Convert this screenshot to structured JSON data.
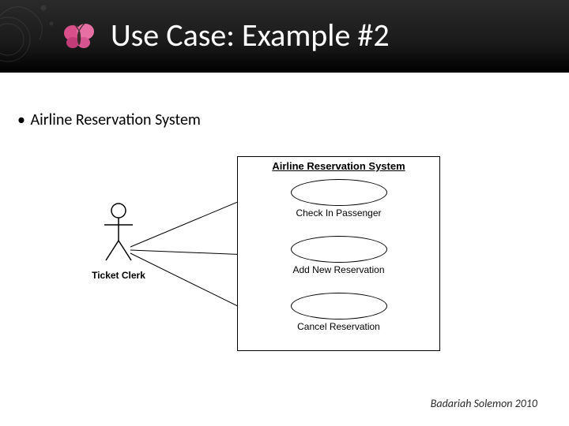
{
  "slide": {
    "title": "Use Case: Example #2",
    "bullet": "Airline Reservation System"
  },
  "diagram": {
    "system_name": "Airline Reservation System",
    "actor": {
      "name": "Ticket Clerk"
    },
    "use_cases": [
      {
        "label": "Check In Passenger"
      },
      {
        "label": "Add New Reservation"
      },
      {
        "label": "Cancel Reservation"
      }
    ]
  },
  "footer": {
    "credit": "Badariah Solemon 2010"
  }
}
